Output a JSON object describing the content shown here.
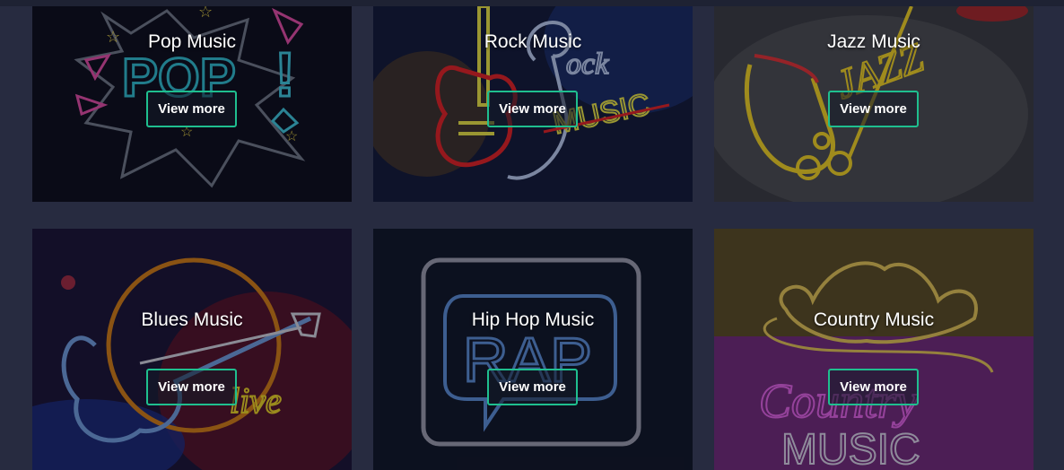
{
  "cards": [
    {
      "title": "Pop Music",
      "button": "View more",
      "art": "neon-pop-icon"
    },
    {
      "title": "Rock Music",
      "button": "View more",
      "art": "neon-rock-guitar-icon"
    },
    {
      "title": "Jazz Music",
      "button": "View more",
      "art": "neon-saxophone-icon"
    },
    {
      "title": "Blues Music",
      "button": "View more",
      "art": "neon-blues-guitar-icon"
    },
    {
      "title": "Hip Hop Music",
      "button": "View more",
      "art": "neon-rap-bubble-icon"
    },
    {
      "title": "Country Music",
      "button": "View more",
      "art": "neon-cowboy-hat-icon"
    }
  ],
  "colors": {
    "background": "#272b40",
    "button_border": "#1fbf8f"
  }
}
